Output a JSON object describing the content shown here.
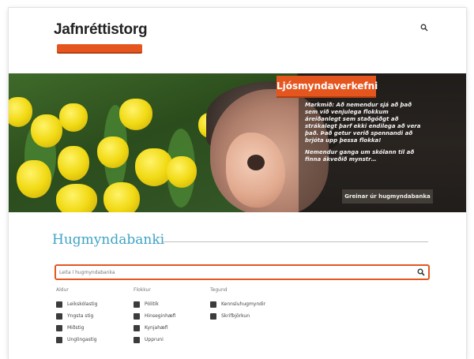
{
  "header": {
    "logo_text": "Jafnréttistorg",
    "search_icon": "search-icon"
  },
  "hero": {
    "tag": "Ljósmyndaverkefni",
    "paragraphs": [
      "Markmið: Að nemendur sjá að það sem við venjulega flokkum áreiðanlegt sem staðgóðgt að strákalegt þarf ekki endilega að vera það. Það getur verið spennandi að brjóta upp þessa flokka!",
      "Nemendur ganga um skólann til að finna ákveðið mynstr…"
    ],
    "button_label": "Greinar úr hugmyndabanka"
  },
  "bank": {
    "title": "Hugmyndabanki",
    "search": {
      "placeholder": "Leita í hugmyndabanka",
      "icon": "search-icon"
    },
    "columns": [
      {
        "heading": "Aldur",
        "items": [
          "Leikskólastig",
          "Yngsta stig",
          "Miðstig",
          "Unglingastig"
        ]
      },
      {
        "heading": "Flokkur",
        "items": [
          "Pólitík",
          "Hinseginhæfi",
          "Kynjahæfi",
          "Uppruni"
        ]
      },
      {
        "heading": "Tegund",
        "items": [
          "Kennsluhugmyndir",
          "Skrifbjörkun"
        ]
      }
    ]
  },
  "colors": {
    "accent": "#e5561f",
    "title_blue": "#3ea3c5"
  }
}
